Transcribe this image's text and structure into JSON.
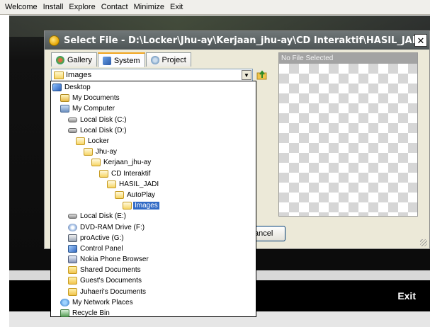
{
  "menu": {
    "items": [
      "Welcome",
      "Install",
      "Explore",
      "Contact",
      "Minimize",
      "Exit"
    ]
  },
  "dialog": {
    "title": "Select File - D:\\Locker\\Jhu-ay\\Kerjaan_jhu-ay\\CD Interaktif\\HASIL_JADI\\AutoPlay...",
    "close_label": "✕",
    "tabs": [
      {
        "label": "Gallery",
        "icon": "gallery-icon",
        "active": false
      },
      {
        "label": "System",
        "icon": "system-icon",
        "active": true
      },
      {
        "label": "Project",
        "icon": "project-icon",
        "active": false
      }
    ],
    "combo_value": "Images",
    "combo_arrow": "▼",
    "preview_header": "No File Selected",
    "cancel_label": "ancel"
  },
  "tree": [
    {
      "label": "Desktop",
      "icon": "desktop-icon",
      "depth": 0,
      "selected": false
    },
    {
      "label": "My Documents",
      "icon": "my-documents-icon",
      "depth": 1,
      "selected": false
    },
    {
      "label": "My Computer",
      "icon": "my-computer-icon",
      "depth": 1,
      "selected": false
    },
    {
      "label": "Local Disk (C:)",
      "icon": "disk-icon",
      "depth": 2,
      "selected": false
    },
    {
      "label": "Local Disk (D:)",
      "icon": "disk-icon",
      "depth": 2,
      "selected": false
    },
    {
      "label": "Locker",
      "icon": "folder-open-icon",
      "depth": 3,
      "selected": false
    },
    {
      "label": "Jhu-ay",
      "icon": "folder-open-icon",
      "depth": 4,
      "selected": false
    },
    {
      "label": "Kerjaan_jhu-ay",
      "icon": "folder-open-icon",
      "depth": 5,
      "selected": false
    },
    {
      "label": "CD Interaktif",
      "icon": "folder-open-icon",
      "depth": 6,
      "selected": false
    },
    {
      "label": "HASIL_JADI",
      "icon": "folder-open-icon",
      "depth": 7,
      "selected": false
    },
    {
      "label": "AutoPlay",
      "icon": "folder-open-icon",
      "depth": 8,
      "selected": false
    },
    {
      "label": "Images",
      "icon": "folder-open-icon",
      "depth": 9,
      "selected": true
    },
    {
      "label": "Local Disk (E:)",
      "icon": "disk-icon",
      "depth": 2,
      "selected": false
    },
    {
      "label": "DVD-RAM Drive (F:)",
      "icon": "dvd-icon",
      "depth": 2,
      "selected": false
    },
    {
      "label": "proActive (G:)",
      "icon": "drive-icon",
      "depth": 2,
      "selected": false
    },
    {
      "label": "Control Panel",
      "icon": "control-panel-icon",
      "depth": 2,
      "selected": false
    },
    {
      "label": "Nokia Phone Browser",
      "icon": "nokia-icon",
      "depth": 2,
      "selected": false
    },
    {
      "label": "Shared Documents",
      "icon": "folder-icon",
      "depth": 2,
      "selected": false
    },
    {
      "label": "Guest's Documents",
      "icon": "folder-icon",
      "depth": 2,
      "selected": false
    },
    {
      "label": "Juhaeri's Documents",
      "icon": "folder-icon",
      "depth": 2,
      "selected": false
    },
    {
      "label": "My Network Places",
      "icon": "network-icon",
      "depth": 1,
      "selected": false
    },
    {
      "label": "Recycle Bin",
      "icon": "recycle-bin-icon",
      "depth": 1,
      "selected": false
    }
  ],
  "footer": {
    "exit_label": "Exit"
  },
  "colors": {
    "selection": "#316ac5",
    "dialog_bg": "#ece9d8",
    "titlebar": "#5a6162"
  }
}
